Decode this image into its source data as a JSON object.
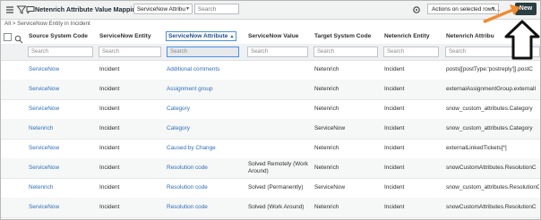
{
  "toolbar": {
    "title": "Netenrich Attribute Value Mappings",
    "filter_select": "ServiceNow Attribu",
    "search_placeholder": "Search",
    "actions_label": "Actions on selected rows...",
    "new_label": "New"
  },
  "breadcrumb": "All > ServiceNow Entity in Incident",
  "columns": [
    {
      "label": "Source System Code",
      "search": "Search"
    },
    {
      "label": "ServiceNow Entity",
      "search": "Search"
    },
    {
      "label": "ServiceNow Attribute",
      "search": "Search"
    },
    {
      "label": "ServiceNow Value",
      "search": "Search"
    },
    {
      "label": "Target System Code",
      "search": "Search"
    },
    {
      "label": "Netenrich Entity",
      "search": "Search"
    },
    {
      "label": "Netenrich Attribu",
      "search": "Search"
    }
  ],
  "rows": [
    {
      "source": "ServiceNow",
      "entity": "Incident",
      "attribute": "Additional comments",
      "value": "",
      "target": "Netenrich",
      "ne_entity": "Incident",
      "ne_attr": "posts[[postType:'postreply']].postC"
    },
    {
      "source": "ServiceNow",
      "entity": "Incident",
      "attribute": "Assignment group",
      "value": "",
      "target": "Netenrich",
      "ne_entity": "Incident",
      "ne_attr": "externalAssignmentGroup.externalI"
    },
    {
      "source": "ServiceNow",
      "entity": "Incident",
      "attribute": "Category",
      "value": "",
      "target": "Netenrich",
      "ne_entity": "Incident",
      "ne_attr": "snow_custom_attributes.Category"
    },
    {
      "source": "Netenrich",
      "entity": "Incident",
      "attribute": "Category",
      "value": "",
      "target": "ServiceNow",
      "ne_entity": "Incident",
      "ne_attr": "snow_custom_attributes.Category"
    },
    {
      "source": "ServiceNow",
      "entity": "Incident",
      "attribute": "Caused by Change",
      "value": "",
      "target": "Netenrich",
      "ne_entity": "Incident",
      "ne_attr": "externalLinkedTickets[*]"
    },
    {
      "source": "ServiceNow",
      "entity": "Incident",
      "attribute": "Resolution code",
      "value": "Solved Remotely (Work Around)",
      "target": "Netenrich",
      "ne_entity": "Incident",
      "ne_attr": "snowCustomAttributes.ResolutionC"
    },
    {
      "source": "Netenrich",
      "entity": "Incident",
      "attribute": "Resolution code",
      "value": "Solved (Permanently)",
      "target": "ServiceNow",
      "ne_entity": "Incident",
      "ne_attr": "snow_custom_attributes.ResolutionC"
    },
    {
      "source": "ServiceNow",
      "entity": "Incident",
      "attribute": "Resolution code",
      "value": "Solved (Work Around)",
      "target": "Netenrich",
      "ne_entity": "Incident",
      "ne_attr": "snowCustomAttributes.ResolutionC"
    }
  ],
  "colors": {
    "link": "#2f6fba",
    "new_button": "#293e40",
    "annotation_arrow": "#f28a2e"
  }
}
